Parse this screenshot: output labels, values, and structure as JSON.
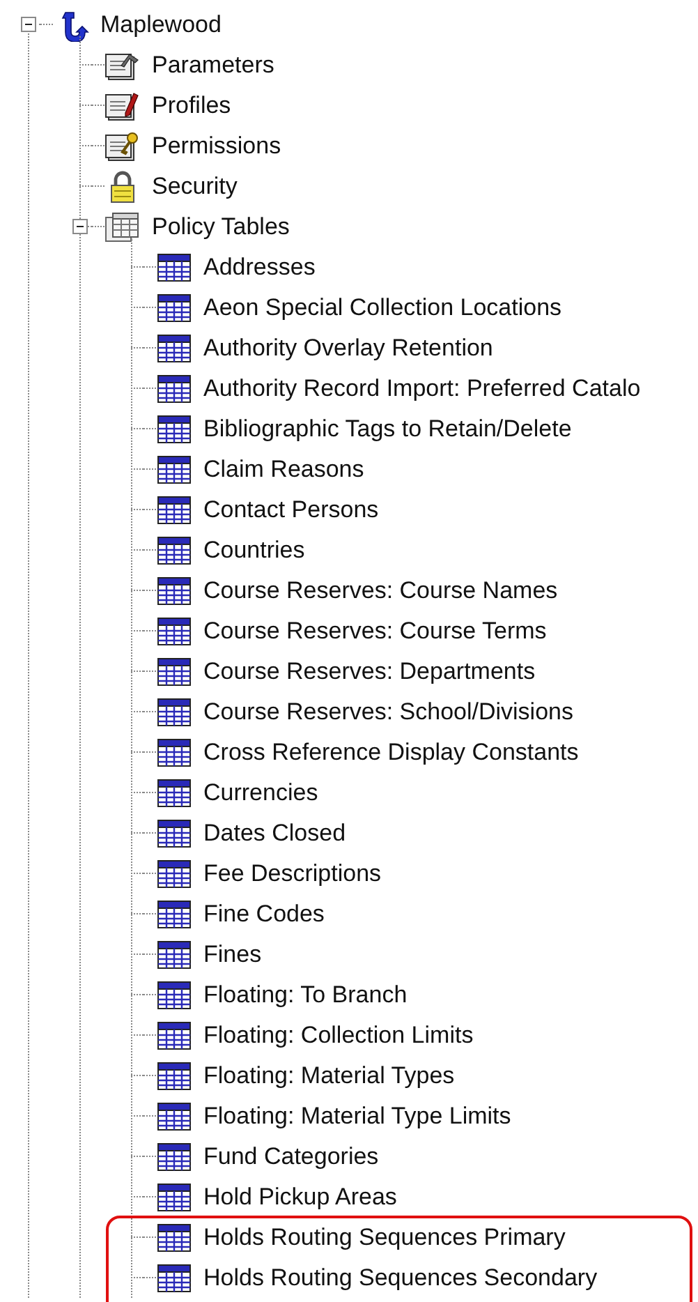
{
  "tree": {
    "label": "Maplewood",
    "kind": "anchor",
    "expanded": true,
    "children": [
      {
        "label": "Parameters",
        "kind": "parameters"
      },
      {
        "label": "Profiles",
        "kind": "profiles"
      },
      {
        "label": "Permissions",
        "kind": "permissions"
      },
      {
        "label": "Security",
        "kind": "lock"
      },
      {
        "label": "Policy Tables",
        "kind": "policy",
        "expanded": true,
        "children": [
          {
            "label": "Addresses",
            "kind": "table",
            "highlighted": false
          },
          {
            "label": "Aeon Special Collection Locations",
            "kind": "table",
            "highlighted": false
          },
          {
            "label": "Authority Overlay Retention",
            "kind": "table",
            "highlighted": false
          },
          {
            "label": "Authority Record Import: Preferred Catalo",
            "kind": "table",
            "highlighted": false
          },
          {
            "label": "Bibliographic Tags to Retain/Delete",
            "kind": "table",
            "highlighted": false
          },
          {
            "label": "Claim Reasons",
            "kind": "table",
            "highlighted": false
          },
          {
            "label": "Contact Persons",
            "kind": "table",
            "highlighted": false
          },
          {
            "label": "Countries",
            "kind": "table",
            "highlighted": false
          },
          {
            "label": "Course Reserves: Course Names",
            "kind": "table",
            "highlighted": false
          },
          {
            "label": "Course Reserves: Course Terms",
            "kind": "table",
            "highlighted": false
          },
          {
            "label": "Course Reserves: Departments",
            "kind": "table",
            "highlighted": false
          },
          {
            "label": "Course Reserves: School/Divisions",
            "kind": "table",
            "highlighted": false
          },
          {
            "label": "Cross Reference Display Constants",
            "kind": "table",
            "highlighted": false
          },
          {
            "label": "Currencies",
            "kind": "table",
            "highlighted": false
          },
          {
            "label": "Dates Closed",
            "kind": "table",
            "highlighted": false
          },
          {
            "label": "Fee Descriptions",
            "kind": "table",
            "highlighted": false
          },
          {
            "label": "Fine Codes",
            "kind": "table",
            "highlighted": false
          },
          {
            "label": "Fines",
            "kind": "table",
            "highlighted": false
          },
          {
            "label": "Floating: To Branch",
            "kind": "table",
            "highlighted": false
          },
          {
            "label": "Floating: Collection Limits",
            "kind": "table",
            "highlighted": false
          },
          {
            "label": "Floating: Material Types",
            "kind": "table",
            "highlighted": false
          },
          {
            "label": "Floating: Material Type Limits",
            "kind": "table",
            "highlighted": false
          },
          {
            "label": "Fund Categories",
            "kind": "table",
            "highlighted": false
          },
          {
            "label": "Hold Pickup Areas",
            "kind": "table",
            "highlighted": false
          },
          {
            "label": "Holds Routing Sequences Primary",
            "kind": "table",
            "highlighted": true
          },
          {
            "label": "Holds Routing Sequences Secondary",
            "kind": "table",
            "highlighted": true
          }
        ]
      }
    ]
  }
}
